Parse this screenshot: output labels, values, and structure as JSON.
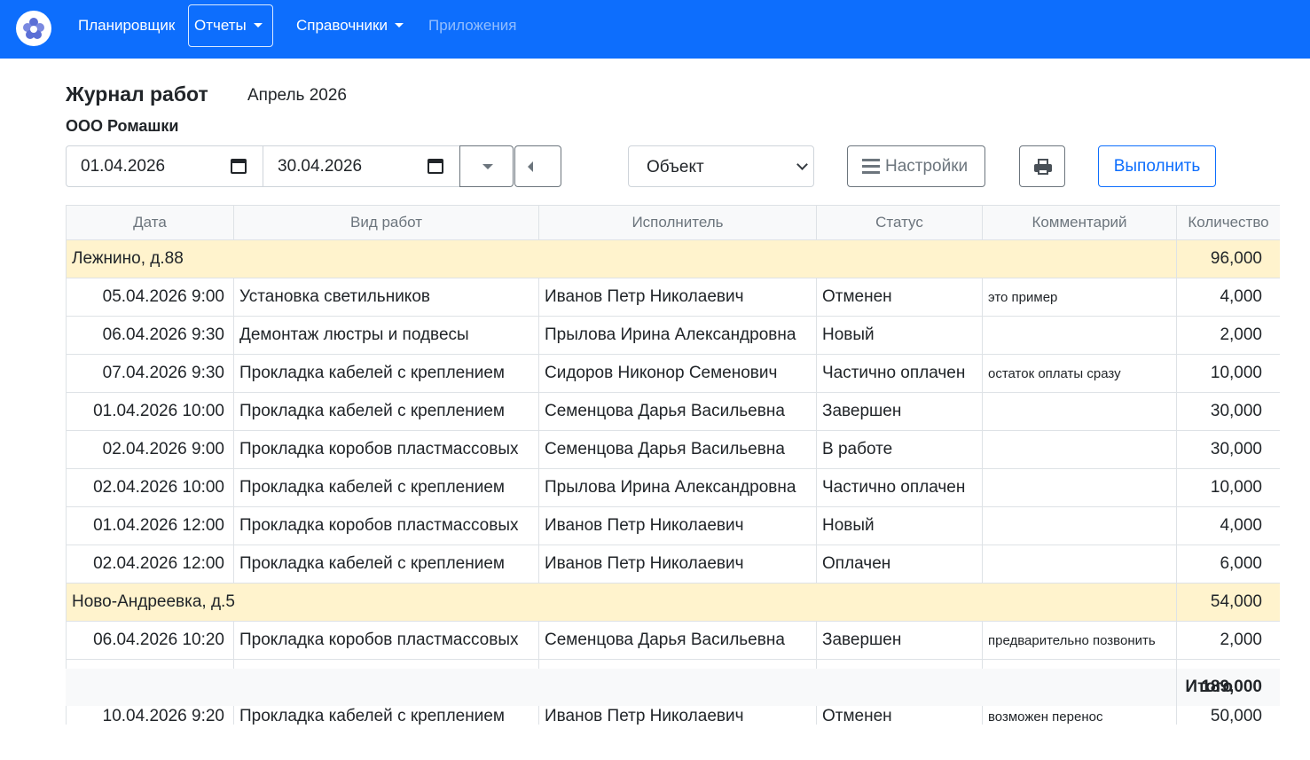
{
  "nav": {
    "items": [
      {
        "label": "Планировщик"
      },
      {
        "label": "Отчеты"
      },
      {
        "label": "Справочники"
      },
      {
        "label": "Приложения"
      }
    ]
  },
  "header": {
    "title": "Журнал работ",
    "period": "Апрель 2026",
    "company": "ООО Ромашки"
  },
  "filters": {
    "date_from": "01.04.2026",
    "date_to": "30.04.2026",
    "object_select": "Объект",
    "settings_label": "Настройки",
    "run_label": "Выполнить"
  },
  "table": {
    "columns": [
      "Дата",
      "Вид работ",
      "Исполнитель",
      "Статус",
      "Комментарий",
      "Количество"
    ],
    "groups": [
      {
        "name": "Лежнино, д.88",
        "total": "96,000",
        "rows": [
          {
            "date": "05.04.2026 9:00",
            "work": "Установка светильников",
            "worker": "Иванов Петр Николаевич",
            "status": "Отменен",
            "comment": "это пример",
            "qty": "4,000"
          },
          {
            "date": "06.04.2026 9:30",
            "work": "Демонтаж люстры и подвесы",
            "worker": "Прылова Ирина Александровна",
            "status": "Новый",
            "comment": "",
            "qty": "2,000"
          },
          {
            "date": "07.04.2026 9:30",
            "work": "Прокладка кабелей с креплением",
            "worker": "Сидоров Никонор Семенович",
            "status": "Частично оплачен",
            "comment": "остаток оплаты сразу",
            "qty": "10,000"
          },
          {
            "date": "01.04.2026 10:00",
            "work": "Прокладка кабелей с креплением",
            "worker": "Семенцова Дарья Васильевна",
            "status": "Завершен",
            "comment": "",
            "qty": "30,000"
          },
          {
            "date": "02.04.2026 9:00",
            "work": "Прокладка коробов пластмассовых",
            "worker": "Семенцова Дарья Васильевна",
            "status": "В работе",
            "comment": "",
            "qty": "30,000"
          },
          {
            "date": "02.04.2026 10:00",
            "work": "Прокладка кабелей с креплением",
            "worker": "Прылова Ирина Александровна",
            "status": "Частично оплачен",
            "comment": "",
            "qty": "10,000"
          },
          {
            "date": "01.04.2026 12:00",
            "work": "Прокладка коробов пластмассовых",
            "worker": "Иванов Петр Николаевич",
            "status": "Новый",
            "comment": "",
            "qty": "4,000"
          },
          {
            "date": "02.04.2026 12:00",
            "work": "Прокладка кабелей с креплением",
            "worker": "Иванов Петр Николаевич",
            "status": "Оплачен",
            "comment": "",
            "qty": "6,000"
          }
        ]
      },
      {
        "name": "Ново-Андреевка, д.5",
        "total": "54,000",
        "rows": [
          {
            "date": "06.04.2026 10:20",
            "work": "Прокладка коробов пластмассовых",
            "worker": "Семенцова Дарья Васильевна",
            "status": "Завершен",
            "comment": "предварительно позвонить",
            "qty": "2,000"
          },
          {
            "date": "",
            "work": "",
            "worker": "",
            "status": "",
            "comment": "",
            "qty": ""
          },
          {
            "date": "10.04.2026 9:20",
            "work": "Прокладка кабелей с креплением",
            "worker": "Иванов Петр Николаевич",
            "status": "Отменен",
            "comment": "возможен перенос",
            "qty": "50,000"
          }
        ]
      }
    ]
  },
  "totals": {
    "label": "Итого",
    "value": "189,000"
  }
}
